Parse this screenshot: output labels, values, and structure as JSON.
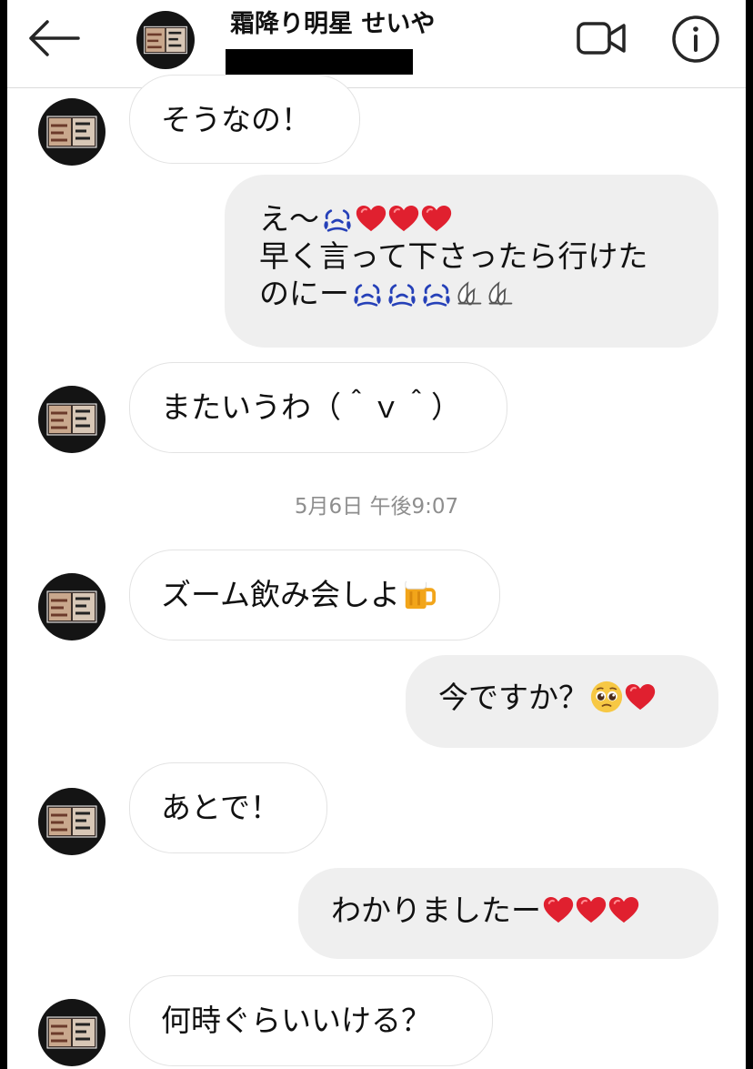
{
  "header": {
    "contact_name": "霜降り明星 せいや",
    "back_icon": "arrow-left-icon",
    "video_icon": "video-camera-icon",
    "info_icon": "info-icon"
  },
  "messages": [
    {
      "side": "in",
      "text": "そうなの！"
    },
    {
      "side": "out",
      "lines": [
        "え〜",
        "早く言って下さったら行けた",
        "のにー"
      ],
      "emoji": [
        "crying-face-emoji",
        "red-heart-emoji",
        "red-heart-emoji",
        "red-heart-emoji",
        "crying-face-emoji",
        "crying-face-emoji",
        "crying-face-emoji",
        "sweat-droplets-emoji",
        "sweat-droplets-emoji"
      ]
    },
    {
      "side": "in",
      "text": "またいうわ（＾ｖ＾）"
    },
    {
      "side": "in",
      "text": "ズーム飲み会しよ",
      "emoji": [
        "beer-mug-emoji"
      ]
    },
    {
      "side": "out",
      "text": "今ですか？",
      "emoji": [
        "pleading-face-emoji",
        "red-heart-emoji"
      ]
    },
    {
      "side": "in",
      "text": "あとで！"
    },
    {
      "side": "out",
      "text": "わかりましたー",
      "emoji": [
        "red-heart-emoji",
        "red-heart-emoji",
        "red-heart-emoji"
      ]
    },
    {
      "side": "in",
      "text": "何時ぐらいいける？"
    }
  ],
  "timestamp": "5月6日 午後9:07",
  "colors": {
    "heart": "#e0202f",
    "crying": "#2540b8",
    "bubble_out": "#efefef",
    "timestamp": "#8e8e8e"
  }
}
